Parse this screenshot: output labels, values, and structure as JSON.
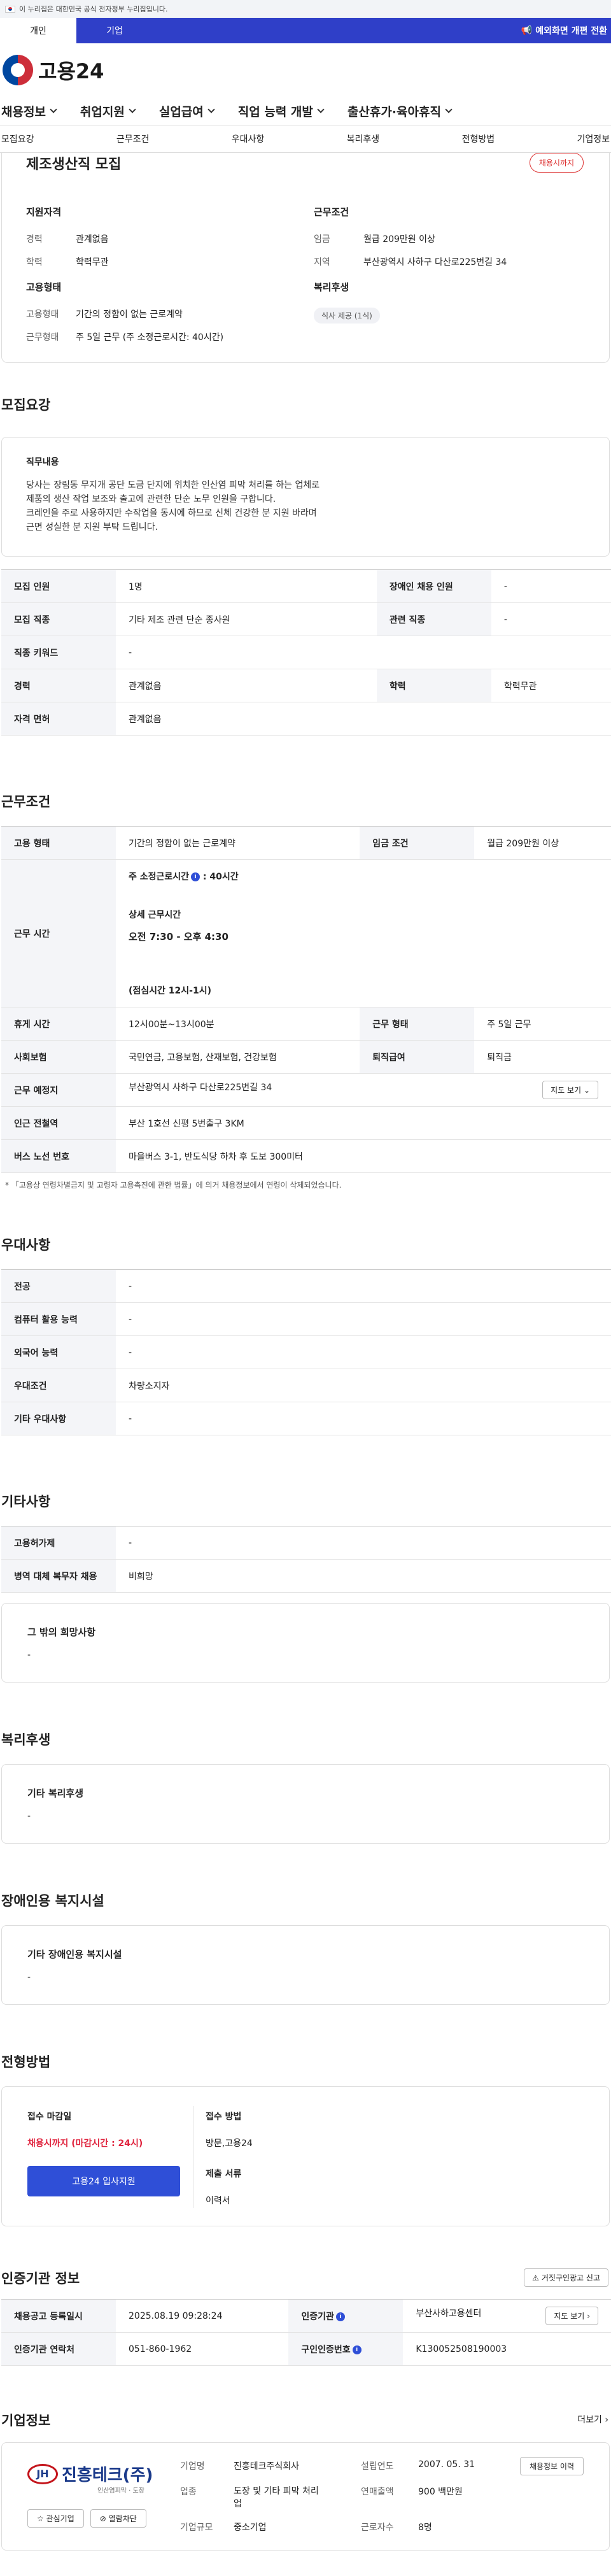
{
  "gov_bar": {
    "text": "이 누리집은 대한민국 공식 전자정부 누리집입니다."
  },
  "user_tabs": {
    "personal": "개인",
    "company": "기업",
    "notice": "예외화면 개편 전환"
  },
  "logo": {
    "text": "고용24"
  },
  "main_nav": [
    "채용정보",
    "취업지원",
    "실업급여",
    "직업 능력 개발",
    "출산휴가·육아휴직"
  ],
  "sub_nav": [
    "모집요강",
    "근무조건",
    "우대사항",
    "복리후생",
    "전형방법",
    "기업정보"
  ],
  "summary": {
    "title": "제조생산직 모집",
    "status": "채용시까지",
    "qual_title": "지원자격",
    "career_k": "경력",
    "career_v": "관계없음",
    "edu_k": "학력",
    "edu_v": "학력무관",
    "cond_title": "근무조건",
    "wage_k": "임금",
    "wage_v": "월급 209만원 이상",
    "area_k": "지역",
    "area_v": "부산광역시 사하구 다산로225번길 34",
    "emp_title": "고용형태",
    "emp_k": "고용형태",
    "emp_v": "기간의 정함이 없는 근로계약",
    "worktype_k": "근무형태",
    "worktype_v": "주 5일 근무 (주 소정근로시간: 40시간)",
    "welfare_title": "복리후생",
    "welfare_chip": "식사 제공 (1식)"
  },
  "recruit": {
    "section_title": "모집요강",
    "desc_title": "직무내용",
    "desc_lines": [
      "당사는 장림동 무지개 공단 도금 단지에 위치한 인산염 피막 처리를 하는 업체로",
      "제품의 생산 작업 보조와 출고에 관련한 단순 노무 인원을 구합니다.",
      "크레인을 주로 사용하지만 수작업을 동시에 하므로 신체 건강한 분 지원 바라며",
      "근면 성실한 분 지원 부탁 드립니다."
    ],
    "rows": {
      "count_k": "모집 인원",
      "count_v": "1명",
      "disabled_k": "장애인 채용 인원",
      "disabled_v": "-",
      "job_k": "모집 직종",
      "job_v": "기타 제조 관련 단순 종사원",
      "related_k": "관련 직종",
      "related_v": "-",
      "keyword_k": "직종 키워드",
      "keyword_v": "-",
      "career_k": "경력",
      "career_v": "관계없음",
      "edu_k": "학력",
      "edu_v": "학력무관",
      "license_k": "자격 면허",
      "license_v": "관계없음"
    }
  },
  "conditions": {
    "section_title": "근무조건",
    "emp_k": "고용 형태",
    "emp_v": "기간의 정함이 없는 근로계약",
    "wage_k": "임금 조건",
    "wage_v": "월급 209만원 이상",
    "hours_k": "근무 시간",
    "hours_weekly_label": "주 소정근로시간",
    "hours_weekly_value": ": 40시간",
    "hours_detail_label": "상세 근무시간",
    "hours_detail_value": "오전 7:30 - 오후 4:30",
    "hours_break": "(점심시간 12시-1시)",
    "rest_k": "휴게 시간",
    "rest_v": "12시00분~13시00분",
    "worktype_k": "근무 형태",
    "worktype_v": "주 5일 근무",
    "insurance_k": "사회보험",
    "insurance_v": "국민연금, 고용보험, 산재보험, 건강보험",
    "severance_k": "퇴직급여",
    "severance_v": "퇴직금",
    "location_k": "근무 예정지",
    "location_v": "부산광역시 사하구 다산로225번길 34",
    "map_btn": "지도 보기",
    "subway_k": "인근 전철역",
    "subway_v": "부산 1호선 신평 5번출구 3KM",
    "bus_k": "버스 노선 번호",
    "bus_v": "마을버스 3-1, 반도식당 하차 후 도보 300미터",
    "footnote": "* 「고용상 연령차별금지 및 고령자 고용촉진에 관한 법률」에 의거 채용정보에서 연령이 삭제되었습니다."
  },
  "preference": {
    "section_title": "우대사항",
    "major_k": "전공",
    "major_v": "-",
    "computer_k": "컴퓨터 활용 능력",
    "computer_v": "-",
    "language_k": "외국어 능력",
    "language_v": "-",
    "cond_k": "우대조건",
    "cond_v": "차량소지자",
    "etc_k": "기타 우대사항",
    "etc_v": "-"
  },
  "etc": {
    "section_title": "기타사항",
    "subsidy_k": "고용허가제",
    "subsidy_v": "-",
    "military_k": "병역 대체 복무자 채용",
    "military_v": "비희망",
    "hope_title": "그 밖의 희망사항",
    "hope_v": "-"
  },
  "welfare": {
    "section_title": "복리후생",
    "box_title": "기타 복리후생",
    "box_v": "-"
  },
  "disabled": {
    "section_title": "장애인용 복지시설",
    "box_title": "기타 장애인용 복지시설",
    "box_v": "-"
  },
  "selection": {
    "section_title": "전형방법",
    "deadline_label": "접수 마감일",
    "deadline_value": "채용시까지 (마감시간 : 24시)",
    "apply_btn": "고용24 입사지원",
    "method_label": "접수 방법",
    "method_value": "방문,고용24",
    "docs_label": "제출 서류",
    "docs_value": "이력서"
  },
  "agency": {
    "section_title": "인증기관 정보",
    "report_btn": "거짓구인광고 신고",
    "date_k": "채용공고 등록일시",
    "date_v": "2025.08.19 09:28:24",
    "agency_k": "인증기관",
    "agency_v": "부산사하고용센터",
    "map_btn": "지도 보기",
    "contact_k": "인증기관 연락처",
    "contact_v": "051-860-1962",
    "auth_k": "구인인증번호",
    "auth_v": "K130052508190003"
  },
  "company": {
    "section_title": "기업정보",
    "more": "더보기",
    "logo_badge": "JH",
    "logo_name": "진흥테크(주)",
    "logo_sub": "인산염피막 · 도장",
    "interest_btn": "관심기업",
    "block_btn": "열람차단",
    "name_k": "기업명",
    "name_v": "진흥테크주식회사",
    "founded_k": "설립연도",
    "founded_v": "2007. 05. 31",
    "industry_k": "업종",
    "industry_v": "도장 및 기타 피막 처리업",
    "sales_k": "연매출액",
    "sales_v": "900 백만원",
    "employees_k": "근로자수",
    "employees_v": "8명",
    "scale_k": "기업규모",
    "scale_v": "중소기업",
    "history_btn": "채용정보 이력"
  }
}
